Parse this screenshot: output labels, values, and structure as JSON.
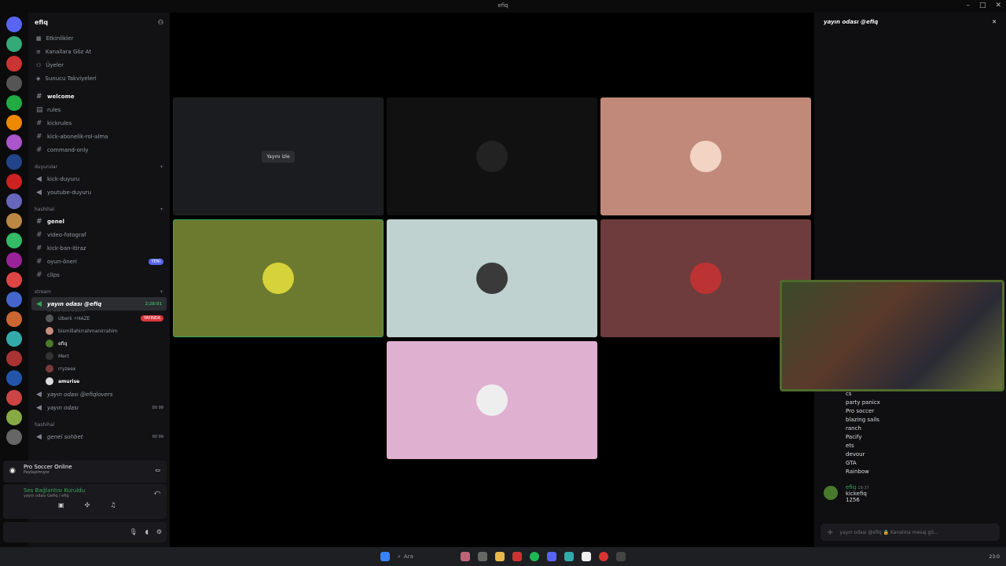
{
  "window": {
    "title": "efiq"
  },
  "server": {
    "name": "efiq"
  },
  "nav": [
    "Etkinlikler",
    "Kanallara Göz At",
    "Üyeler",
    "Sunucu Takviyeleri"
  ],
  "channels": [
    {
      "name": "welcome",
      "bold": true
    },
    {
      "name": "rules"
    },
    {
      "name": "kickrules"
    },
    {
      "name": "kick-abonelik-rol-alma"
    },
    {
      "name": "command-only"
    }
  ],
  "cat_duyurular": "duyurular",
  "duyuru_channels": [
    "kick-duyuru",
    "youtube-duyuru"
  ],
  "cat_hashihal": "hashihal",
  "hashihal_channels": [
    {
      "name": "genel",
      "bold": true
    },
    {
      "name": "video-fotograf"
    },
    {
      "name": "kick-ban-itiraz"
    },
    {
      "name": "oyun-öneri",
      "tag": "YENİ"
    },
    {
      "name": "clips"
    }
  ],
  "cat_stream": "stream",
  "active_voice": {
    "name": "yayın odası @efiq",
    "status": "Bir kanal durumu belirle",
    "time": "2:28:01"
  },
  "voice_users": [
    {
      "name": "Uberk ⚡HAZE",
      "tag": "YAYINDA",
      "color": "#555"
    },
    {
      "name": "bismillahirrahmanirrahim",
      "color": "#c98d7d"
    },
    {
      "name": "efiq",
      "color": "#4a7a2c"
    },
    {
      "name": "Mert",
      "color": "#333"
    },
    {
      "name": "rryzeex",
      "color": "#7a3b3b"
    },
    {
      "name": "amurise",
      "color": "#ddd"
    }
  ],
  "other_voice": [
    {
      "name": "yayın odası @efiqlovers",
      "count": ""
    },
    {
      "name": "yayın odası",
      "count": "00 99"
    }
  ],
  "cat_hashihal2": "hashihal",
  "genel_sohbet": {
    "name": "genel sohbet",
    "count": "00 99"
  },
  "activity": {
    "title": "Pro Soccer Online",
    "sub": "Paylaşılmıyor"
  },
  "voice_status": {
    "title": "Ses Bağlantısı Kuruldu",
    "sub": "yayın odası Gefiq / efiq"
  },
  "stream_tile": {
    "label": "Yayını izle"
  },
  "tiles": [
    {
      "bg": "#111",
      "circle": "#333"
    },
    {
      "bg": "#c0897a",
      "circle": "#f2d3c4"
    },
    {
      "bg": "#6b7a2e",
      "circle": "#d6d23a"
    },
    {
      "bg": "#bfd2d0",
      "circle": "#3a3a3a"
    },
    {
      "bg": "#6e3c3c",
      "circle": "#b33"
    },
    {
      "bg": "#e0b0d0",
      "circle": "#eee"
    }
  ],
  "chat": {
    "header": "yayın odası @efiq",
    "list": [
      "cs",
      "party panicx",
      "Pro soccer",
      "blazing sails",
      "ranch",
      "Pacify",
      "ets",
      "devour",
      "GTA",
      "Rainbow"
    ],
    "msg": {
      "author": "efiq",
      "time": "18:37",
      "lines": [
        "kickefiq",
        "1256"
      ]
    },
    "placeholder": "yayın odası @efiq 🔒 Kanalına mesaj gö..."
  },
  "taskbar": {
    "search": "Ara",
    "time": "23:0"
  }
}
